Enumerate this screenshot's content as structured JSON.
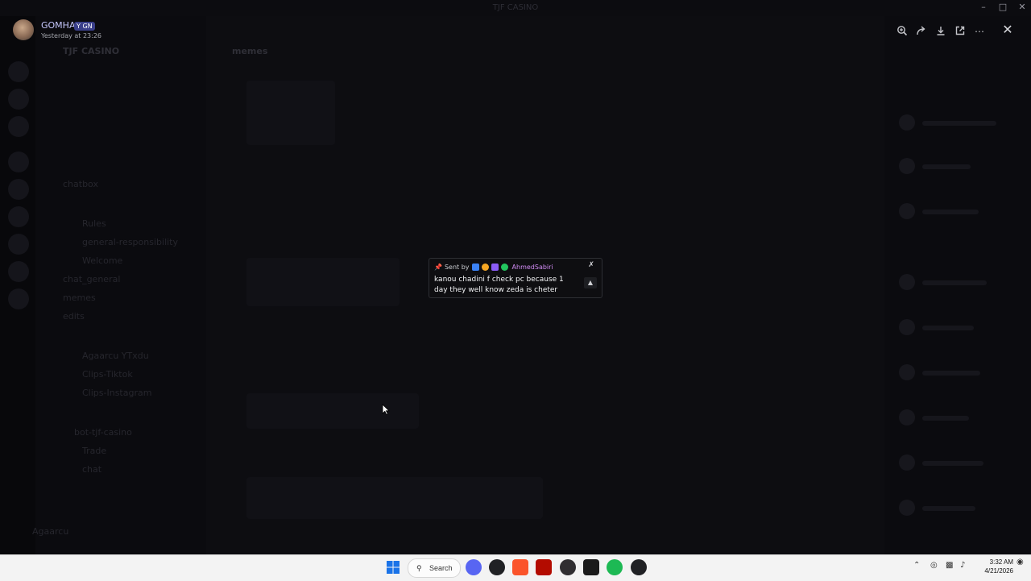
{
  "window": {
    "title": "TJF CASINO",
    "controls": [
      "minimize-icon",
      "maximize-icon",
      "close-icon"
    ]
  },
  "viewer": {
    "author": "GOMHA",
    "tag": "GN",
    "timestamp": "Yesterday at 23:26",
    "actions": [
      "zoom-icon",
      "forward-icon",
      "download-icon",
      "open-external-icon",
      "more-icon"
    ],
    "close_icon": "close-icon"
  },
  "pinned_card": {
    "sent_by": "Sent by",
    "author": "AhmedSabiri",
    "message": "kanou chadini f check pc because 1 day they well know zeda is cheter",
    "author_color": "#d28cf5"
  },
  "taskbar": {
    "search_label": "Search",
    "apps": [
      "start-icon",
      "discord-icon",
      "chrome-icon",
      "brave-icon",
      "acrobat-icon",
      "obs-icon",
      "capcut-icon",
      "spotify-icon",
      "chrome-icon-2"
    ],
    "time": "3:32 AM",
    "date": "4/21/2026"
  },
  "background": {
    "server_name": "TJF CASINO",
    "channel": "memes",
    "channels": [
      "chatbox",
      "Rules",
      "general-responsibility",
      "Welcome",
      "chat_general",
      "memes",
      "edits",
      "Agaarcu YTxdu",
      "Clips-Tiktok",
      "Clips-Instagram",
      "bot-tjf-casino",
      "Trade",
      "chat"
    ],
    "user": "Agaarcu"
  }
}
